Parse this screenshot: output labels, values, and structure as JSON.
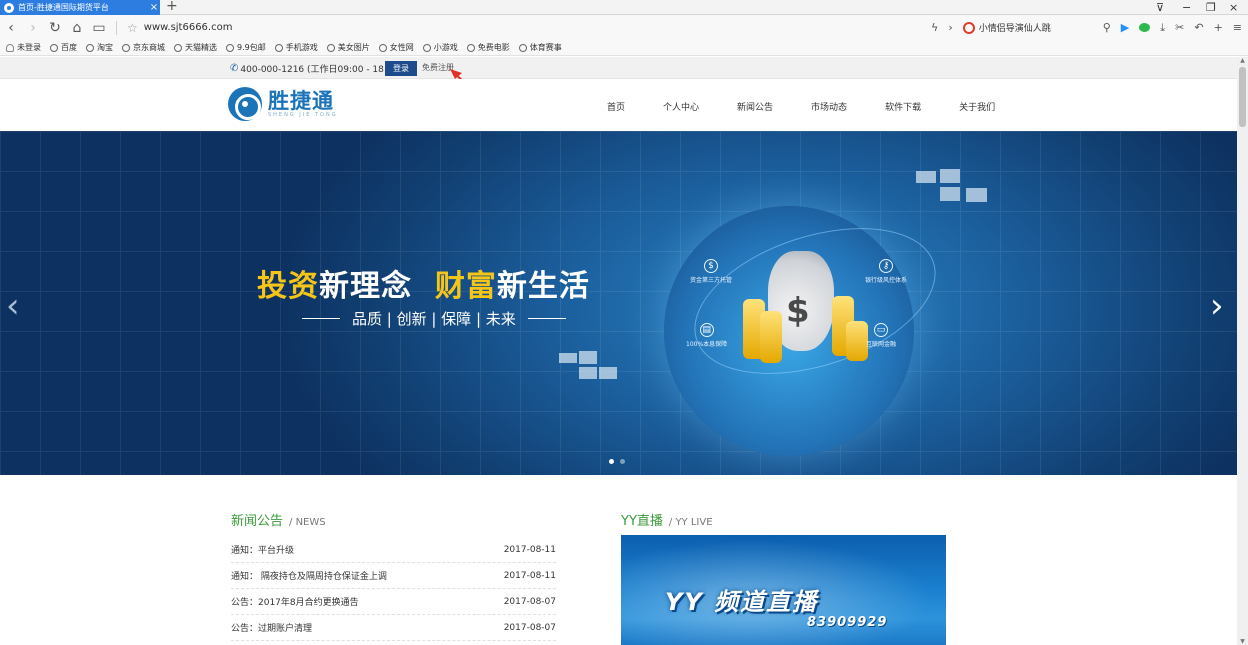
{
  "browser": {
    "tab_title": "首页-胜捷通国际期货平台",
    "tab_close": "×",
    "new_tab": "+",
    "url": "www.sjt6666.com",
    "search_text": "小情侣导演仙人跳",
    "window_controls": [
      "⊽",
      "−",
      "❐",
      "×"
    ],
    "bookmarks": {
      "user": "未登录",
      "items": [
        "百度",
        "淘宝",
        "京东商城",
        "天猫精选",
        "9.9包邮",
        "手机游戏",
        "美女图片",
        "女性网",
        "小游戏",
        "免费电影",
        "体育赛事"
      ]
    }
  },
  "topbar": {
    "phone": "400-000-1216 (工作日09:00 - 18:00)",
    "login": "登录",
    "register": "免费注册"
  },
  "header": {
    "logo_cn": "胜捷通",
    "logo_en": "SHENG JIE TONG",
    "nav": [
      "首页",
      "个人中心",
      "新闻公告",
      "市场动态",
      "软件下载",
      "关于我们"
    ]
  },
  "banner": {
    "slogan_hl1": "投资",
    "slogan_1": "新理念",
    "slogan_hl2": "财富",
    "slogan_2": "新生活",
    "subslogan": "品质 | 创新 | 保障 | 未来",
    "features": [
      "资金第三方托管",
      "银行级风控体系",
      "100%本息保障",
      "互联网金融"
    ],
    "arrow_left": "‹",
    "arrow_right": "›",
    "slides": 2,
    "active_slide": 1
  },
  "news": {
    "title": "新闻公告",
    "subtitle": "/ NEWS",
    "items": [
      {
        "title": "通知：平台升级",
        "date": "2017-08-11"
      },
      {
        "title": "通知： 隔夜持仓及隔周持仓保证金上调",
        "date": "2017-08-11"
      },
      {
        "title": "公告：2017年8月合约更换通告",
        "date": "2017-08-07"
      },
      {
        "title": "公告：过期账户清理",
        "date": "2017-08-07"
      }
    ]
  },
  "yy": {
    "title": "YY直播",
    "subtitle": "/ YY LIVE",
    "banner_title": "YY 频道直播",
    "channel": "83909929"
  },
  "colors": {
    "brand_blue": "#1c74b8",
    "login_button": "#1d4b8c",
    "accent_yellow": "#f5c518",
    "section_green": "#3b9a3b",
    "tab_blue": "#2d7de0"
  }
}
